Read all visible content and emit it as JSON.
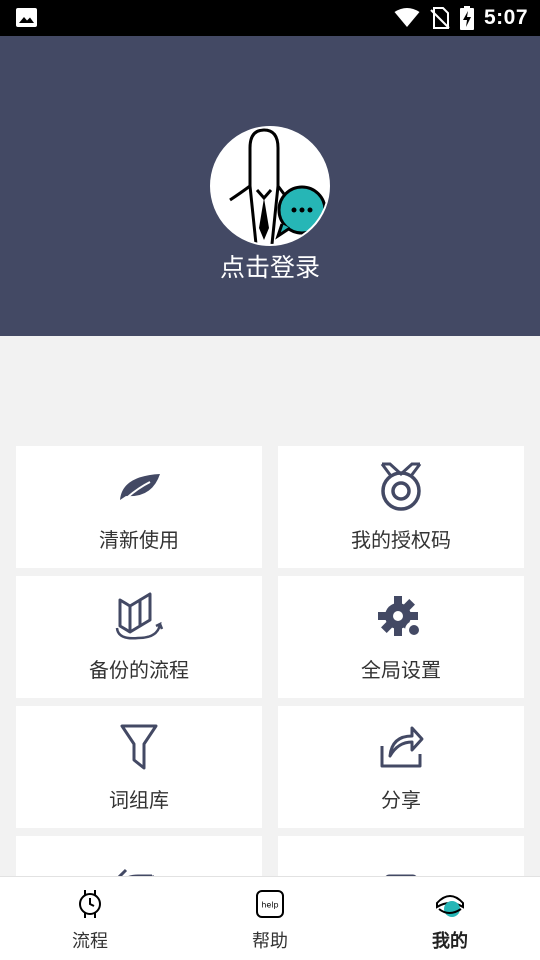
{
  "status_bar": {
    "time": "5:07"
  },
  "header": {
    "login_label": "点击登录"
  },
  "menu": {
    "items": [
      {
        "label": "清新使用",
        "icon": "leaf-icon"
      },
      {
        "label": "我的授权码",
        "icon": "medal-icon"
      },
      {
        "label": "备份的流程",
        "icon": "backup-icon"
      },
      {
        "label": "全局设置",
        "icon": "gear-icon"
      },
      {
        "label": "词组库",
        "icon": "filter-icon"
      },
      {
        "label": "分享",
        "icon": "share-icon"
      },
      {
        "label": "",
        "icon": "refresh-icon"
      },
      {
        "label": "",
        "icon": "inbox-icon"
      }
    ]
  },
  "bottom_nav": {
    "items": [
      {
        "label": "流程",
        "icon": "watch-icon"
      },
      {
        "label": "帮助",
        "icon": "help-icon",
        "icon_text": "help"
      },
      {
        "label": "我的",
        "icon": "profile-icon"
      }
    ]
  },
  "colors": {
    "header_bg": "#434964",
    "accent": "#26b6b6",
    "icon": "#434964"
  }
}
